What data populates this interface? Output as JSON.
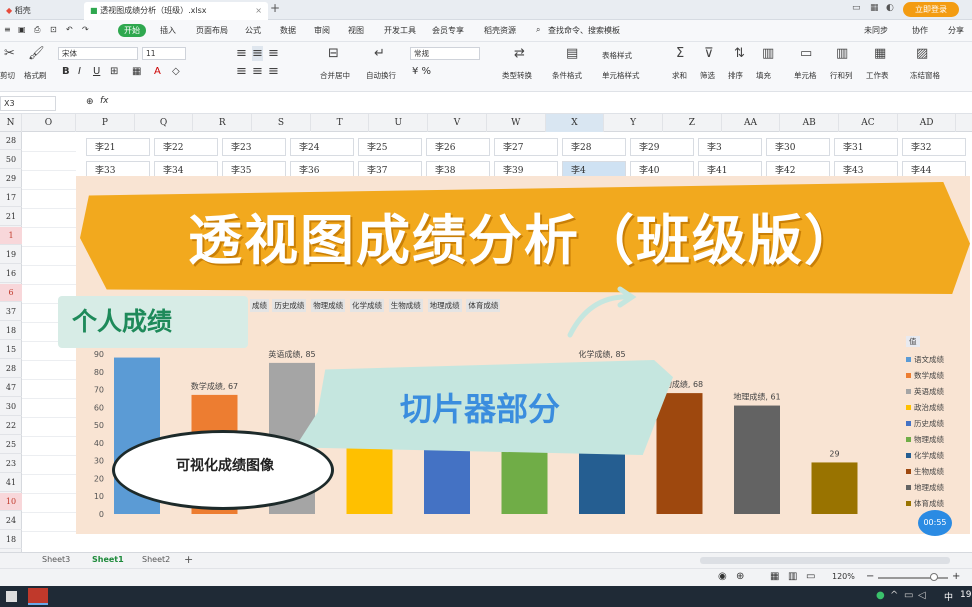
{
  "tabs": {
    "home_tab": "稻壳",
    "file_tab": "透视图成绩分析（班级）.xlsx",
    "new_tab": "+",
    "login": "立即登录"
  },
  "menu": {
    "file_icon": "≡",
    "start": "开始",
    "items": [
      "插入",
      "页面布局",
      "公式",
      "数据",
      "审阅",
      "视图",
      "开发工具",
      "会员专享",
      "稻壳资源"
    ],
    "search": "查找命令、搜索模板",
    "unsync": "未同步",
    "collab": "协作",
    "share": "分享"
  },
  "ribbon": {
    "font_name": "宋体",
    "font_size": "11",
    "format": "常规",
    "labels": [
      "剪切",
      "格式刷",
      "合并居中",
      "自动换行",
      "类型转换",
      "条件格式",
      "单元格样式",
      "求和",
      "筛选",
      "排序",
      "填充",
      "单元格",
      "行和列",
      "工作表",
      "冻结窗格",
      "表格样式"
    ]
  },
  "formula": {
    "name_box": "X3",
    "fx": "fx"
  },
  "columns": [
    "N",
    "O",
    "P",
    "Q",
    "R",
    "S",
    "T",
    "U",
    "V",
    "W",
    "X",
    "Y",
    "Z",
    "AA",
    "AB",
    "AC",
    "AD",
    "AE"
  ],
  "rows": [
    {
      "n": "28",
      "red": false
    },
    {
      "n": "50",
      "red": false
    },
    {
      "n": "29",
      "red": false
    },
    {
      "n": "17",
      "red": false
    },
    {
      "n": "21",
      "red": false
    },
    {
      "n": "1",
      "red": true
    },
    {
      "n": "19",
      "red": false
    },
    {
      "n": "16",
      "red": false
    },
    {
      "n": "6",
      "red": true
    },
    {
      "n": "37",
      "red": false
    },
    {
      "n": "18",
      "red": false
    },
    {
      "n": "15",
      "red": false
    },
    {
      "n": "28",
      "red": false
    },
    {
      "n": "47",
      "red": false
    },
    {
      "n": "30",
      "red": false
    },
    {
      "n": "22",
      "red": false
    },
    {
      "n": "25",
      "red": false
    },
    {
      "n": "23",
      "red": false
    },
    {
      "n": "41",
      "red": false
    },
    {
      "n": "10",
      "red": true
    },
    {
      "n": "24",
      "red": false
    },
    {
      "n": "18",
      "red": false
    }
  ],
  "cells_row1": [
    "李21",
    "李22",
    "李23",
    "李24",
    "李25",
    "李26",
    "李27",
    "李28",
    "李29",
    "李3",
    "李30",
    "李31",
    "李32"
  ],
  "cells_row2": [
    "李33",
    "李34",
    "李35",
    "李36",
    "李37",
    "李38",
    "李39",
    "李4",
    "李40",
    "李41",
    "李42",
    "李43",
    "李44"
  ],
  "slicer_items": [
    "成绩",
    "历史成绩",
    "物理成绩",
    "化学成绩",
    "生物成绩",
    "地理成绩",
    "体育成绩"
  ],
  "overlay": {
    "banner_title": "透视图成绩分析（班级版）",
    "personal": "个人成绩",
    "slicer": "切片器部分",
    "visual": "可视化成绩图像"
  },
  "chart_data": {
    "type": "bar",
    "categories": [
      "语文成绩",
      "数学成绩",
      "英语成绩",
      "政治成绩",
      "历史成绩",
      "物理成绩",
      "化学成绩",
      "生物成绩",
      "地理成绩",
      "体育成绩"
    ],
    "values": [
      88,
      67,
      85,
      73,
      60,
      63,
      85,
      68,
      61,
      29
    ],
    "colors": [
      "#5b9bd5",
      "#ed7d31",
      "#a5a5a5",
      "#ffc000",
      "#4472c4",
      "#70ad47",
      "#255e91",
      "#9e480e",
      "#636363",
      "#997300"
    ],
    "data_labels": [
      "",
      "数学成绩, 67",
      "英语成绩, 85",
      "政",
      "",
      "",
      "化学成绩, 85",
      "生物成绩, 68",
      "地理成绩, 61",
      "29"
    ],
    "yticks": [
      "90",
      "80",
      "70",
      "60",
      "50",
      "40",
      "30",
      "20",
      "10",
      "0"
    ],
    "ylim": [
      0,
      90
    ],
    "legend_title": "值",
    "legend_position": "right"
  },
  "sheets": {
    "tabs": [
      "Sheet3",
      "Sheet1",
      "Sheet2"
    ],
    "add": "+"
  },
  "status": {
    "zoom": "120%",
    "zoom_minus": "−",
    "zoom_plus": "+"
  },
  "overlay_time": "00:55",
  "taskbar": {
    "lang": "中",
    "time": "19"
  }
}
